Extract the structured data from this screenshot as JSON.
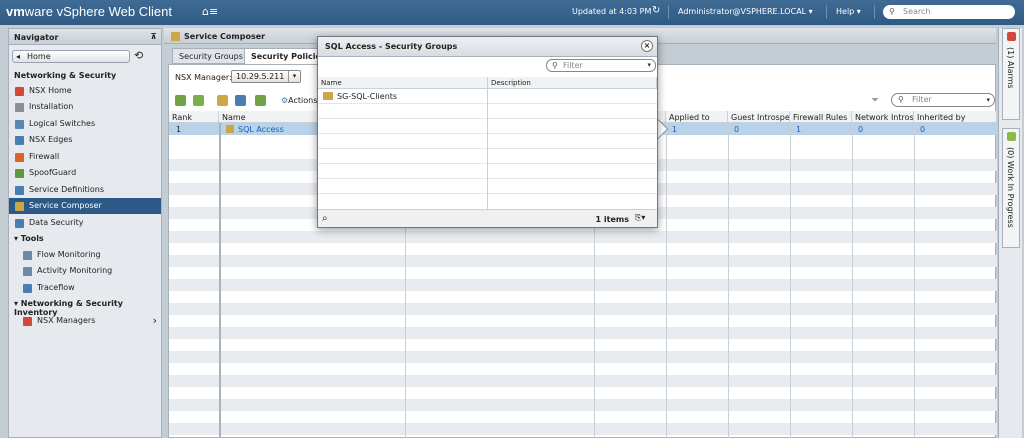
{
  "topbar": {
    "brand_vm": "vm",
    "brand_ware": "ware",
    "brand_app": " vSphere Web Client",
    "home_icon": "⌂≡",
    "updated": "Updated at 4:03 PM",
    "refresh_icon": "↻",
    "user": "Administrator@VSPHERE.LOCAL ▾",
    "help": "Help ▾",
    "search_placeholder": "Search",
    "search_icon": "⚲"
  },
  "navigator": {
    "title": "Navigator",
    "pin_icon": "⊼",
    "home_label": "Home",
    "history_icon": "⟲",
    "section": "Networking & Security",
    "items": [
      {
        "label": "NSX Home",
        "icon_color": "#d2483c"
      },
      {
        "label": "Installation",
        "icon_color": "#8a8f96"
      },
      {
        "label": "Logical Switches",
        "icon_color": "#5a85b4"
      },
      {
        "label": "NSX Edges",
        "icon_color": "#4a7db0"
      },
      {
        "label": "Firewall",
        "icon_color": "#d9632a"
      },
      {
        "label": "SpoofGuard",
        "icon_color": "#5c9a3c"
      },
      {
        "label": "Service Definitions",
        "icon_color": "#4a7db0"
      },
      {
        "label": "Service Composer",
        "icon_color": "#caa84a"
      },
      {
        "label": "Data Security",
        "icon_color": "#4a7db0"
      }
    ],
    "tools_section": "▾ Tools",
    "tools": [
      {
        "label": "Flow Monitoring",
        "icon_color": "#6c8aa8"
      },
      {
        "label": "Activity Monitoring",
        "icon_color": "#6c8aa8"
      },
      {
        "label": "Traceflow",
        "icon_color": "#4a7db0"
      }
    ],
    "inventory_section": "▾ Networking & Security Inventory",
    "inventory": [
      {
        "label": "NSX Managers",
        "icon_color": "#d2483c"
      }
    ],
    "chevron": "›"
  },
  "main": {
    "title": "Service Composer",
    "tabs": [
      "Security Groups",
      "Security Policies"
    ],
    "nsx_manager_label": "NSX Manager:",
    "nsx_manager_value": "10.29.5.211",
    "actions_label": "Actions",
    "filter_placeholder": "Filter",
    "columns": [
      "Rank",
      "Name",
      "Applied to",
      "Guest Introspec...",
      "Firewall Rules",
      "Network Introsp...",
      "Inherited by"
    ],
    "rows": [
      {
        "rank": "1",
        "name": "SQL Access",
        "applied_to": "1",
        "guest": "0",
        "firewall": "1",
        "network": "0",
        "inherited": "0"
      }
    ]
  },
  "right_panel": {
    "alarms": "(1) Alarms",
    "work": "(0) Work In Progress"
  },
  "dialog": {
    "title": "SQL Access - Security Groups",
    "close": "×",
    "filter_placeholder": "Filter",
    "columns": [
      "Name",
      "Description"
    ],
    "rows": [
      {
        "name": "SG-SQL-Clients",
        "description": ""
      }
    ],
    "count": "1 items",
    "binoculars_icon": "⌕",
    "export_icon": "⎘▾"
  }
}
